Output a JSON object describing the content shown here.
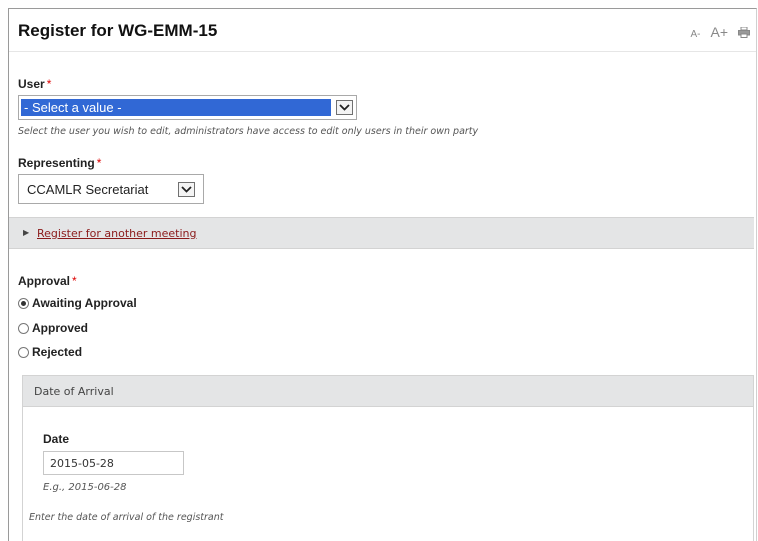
{
  "page": {
    "title": "Register for WG-EMM-15",
    "tools": {
      "font_decrease": "A-",
      "font_increase": "A+",
      "print_icon": "print-icon"
    }
  },
  "form": {
    "user": {
      "label": "User",
      "required_marker": "*",
      "selected_value": "- Select a value -",
      "description": "Select the user you wish to edit, administrators have access to edit only users in their own party"
    },
    "representing": {
      "label": "Representing",
      "required_marker": "*",
      "selected_value": "CCAMLR Secretariat"
    },
    "another_meeting": {
      "link_text": "Register for another meeting",
      "collapsed": true
    },
    "approval": {
      "label": "Approval",
      "required_marker": "*",
      "options": [
        {
          "label": "Awaiting Approval",
          "checked": true
        },
        {
          "label": "Approved",
          "checked": false
        },
        {
          "label": "Rejected",
          "checked": false
        }
      ]
    },
    "date_of_arrival": {
      "legend": "Date of Arrival",
      "date_label": "Date",
      "date_value": "2015-05-28",
      "example": "E.g., 2015-06-28",
      "description": "Enter the date of arrival of the registrant"
    }
  },
  "colors": {
    "selection_blue": "#3168d5",
    "required_red": "#dd0000",
    "link_red": "#8b1a1a",
    "bar_grey": "#e4e5e6"
  }
}
